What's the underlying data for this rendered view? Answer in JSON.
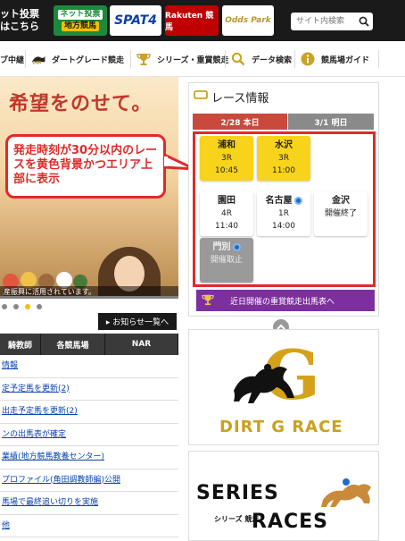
{
  "topbar": {
    "left_text_line1": "ット投票",
    "left_text_line2": "はこちら",
    "netbet_line1": "ネット投票",
    "netbet_line2": "地方競馬",
    "spat_label": "SPAT4",
    "rakuten_label": "Rakuten 競馬",
    "odds_label": "Odds Park",
    "search_placeholder": "サイト内検索"
  },
  "nav": {
    "items": [
      {
        "label": "ブ中継"
      },
      {
        "label": "ダートグレード競走"
      },
      {
        "label": "シリーズ・重賞競走"
      },
      {
        "label": "データ検索"
      },
      {
        "label": "競馬場ガイド"
      }
    ]
  },
  "hero": {
    "title": "希望をのせて。",
    "caption": "産振興に活用されています。"
  },
  "callout": {
    "text": "発走時刻が30分以内のレースを黄色背景かつエリア上部に表示"
  },
  "news": {
    "button_label": "▸ お知らせ一覧へ"
  },
  "left_tabs": [
    "騎教師",
    "各競馬場",
    "NAR"
  ],
  "left_list": [
    "情報",
    "定予定馬を更新(2)",
    "出走予定馬を更新(2)",
    "ンの出馬表が確定",
    "業績(地方競馬教養センター)",
    "プロファイル(角田調教師編)公開",
    "馬場で最終追い切りを実施",
    "他"
  ],
  "race_info": {
    "title": "レース情報",
    "date_active": "2/28 本日",
    "date_other": "3/1 明日",
    "tracks": [
      {
        "name": "浦和",
        "race": "3R",
        "time": "10:45",
        "status": "soon"
      },
      {
        "name": "水沢",
        "race": "3R",
        "time": "11:00",
        "status": "soon"
      },
      {
        "name": "園田",
        "race": "4R",
        "time": "11:40",
        "status": "normal"
      },
      {
        "name": "名古屋",
        "race": "1R",
        "time": "14:00",
        "status": "night"
      },
      {
        "name": "金沢",
        "race": "",
        "time": "開催終了",
        "status": "ended"
      },
      {
        "name": "門別",
        "race": "",
        "time": "開催取止",
        "status": "cancelled"
      }
    ],
    "jusho_button": "近日開催の重賞競走出馬表へ"
  },
  "banners": {
    "dirt_text": "DIRT G RACE",
    "dirt_letter": "G",
    "series_top": "SERIES",
    "series_sub": "シリーズ 競走",
    "series_bot": "RACES"
  },
  "colors": {
    "soon_bg": "#f7d31c",
    "accent_red": "#e02a2a",
    "jusho_purple": "#7d2fa0"
  }
}
